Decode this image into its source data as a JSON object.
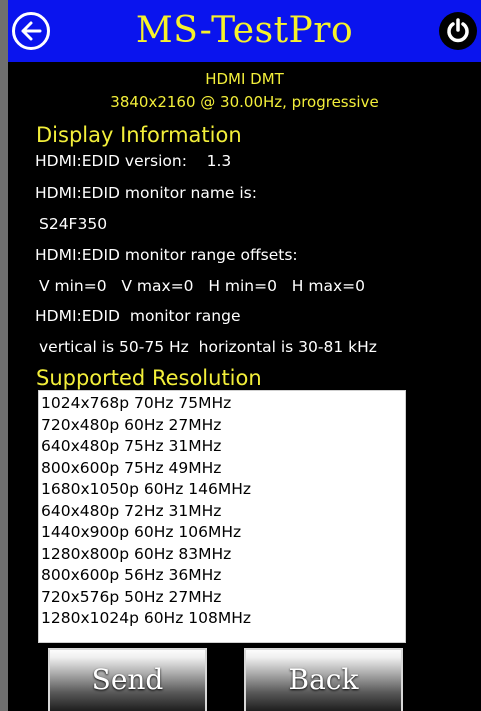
{
  "header": {
    "title": "MS-TestPro",
    "back_icon": "back-arrow-icon",
    "power_icon": "power-icon"
  },
  "mode": {
    "line1": "HDMI DMT",
    "line2": "3840x2160 @ 30.00Hz, progressive"
  },
  "display_info": {
    "title": "Display Information",
    "edid_version": "HDMI:EDID version:    1.3",
    "monitor_name_label": "HDMI:EDID monitor name is:",
    "monitor_name": "S24F350",
    "range_offsets_label": "HDMI:EDID monitor range offsets:",
    "range_offsets": "V min=0   V max=0   H min=0   H max=0",
    "range_label": "HDMI:EDID  monitor range",
    "range": "vertical is 50-75 Hz  horizontal is 30-81 kHz"
  },
  "supported": {
    "title": "Supported Resolution",
    "items": [
      "1024x768p 70Hz 75MHz",
      "720x480p 60Hz 27MHz",
      "640x480p 75Hz 31MHz",
      "800x600p 75Hz 49MHz",
      "1680x1050p 60Hz 146MHz",
      "640x480p 72Hz 31MHz",
      "1440x900p 60Hz 106MHz",
      "1280x800p 60Hz 83MHz",
      "800x600p 56Hz 36MHz",
      "720x576p 50Hz 27MHz",
      "1280x1024p 60Hz 108MHz"
    ]
  },
  "buttons": {
    "send": "Send",
    "back": "Back"
  },
  "colors": {
    "header_bg": "#0a14ee",
    "title_yellow": "#f7f22a",
    "background": "#000000"
  }
}
